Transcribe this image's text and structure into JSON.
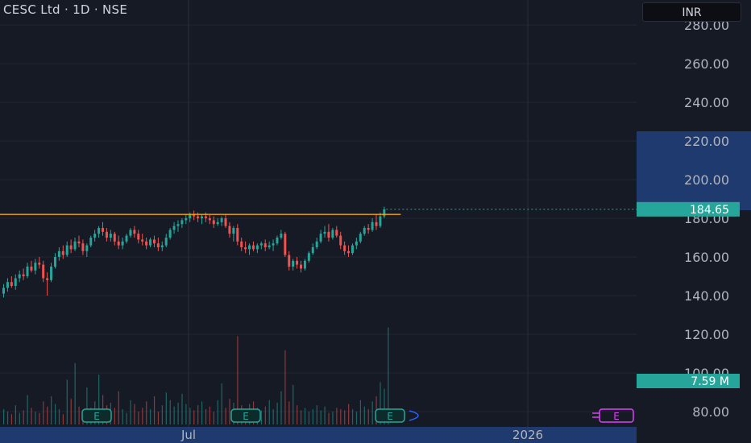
{
  "header": {
    "title": "CESC Ltd · 1D · NSE",
    "currency": "INR"
  },
  "chart_data": {
    "type": "candlestick",
    "y_ticks": [
      "280.00",
      "260.00",
      "240.00",
      "220.00",
      "200.00",
      "180.00",
      "160.00",
      "140.00",
      "120.00",
      "100.00",
      "80.00"
    ],
    "ylim": [
      75,
      285
    ],
    "x_ticks": [
      "Jul",
      "2026"
    ],
    "last_price": "184.65",
    "resistance_level": 182,
    "volume_label": "7.59 M",
    "earnings_marker_label": "E",
    "candles": [
      [
        141,
        146,
        139,
        144
      ],
      [
        144,
        149,
        142,
        147
      ],
      [
        147,
        150,
        144,
        145
      ],
      [
        145,
        151,
        143,
        149
      ],
      [
        149,
        153,
        147,
        151
      ],
      [
        151,
        154,
        148,
        150
      ],
      [
        150,
        157,
        149,
        155
      ],
      [
        155,
        158,
        152,
        153
      ],
      [
        153,
        159,
        151,
        157
      ],
      [
        157,
        160,
        154,
        156
      ],
      [
        156,
        158,
        147,
        149
      ],
      [
        149,
        152,
        140,
        148
      ],
      [
        148,
        157,
        147,
        155
      ],
      [
        155,
        162,
        154,
        160
      ],
      [
        160,
        165,
        158,
        163
      ],
      [
        163,
        166,
        159,
        161
      ],
      [
        161,
        168,
        160,
        166
      ],
      [
        166,
        169,
        162,
        164
      ],
      [
        164,
        170,
        163,
        168
      ],
      [
        168,
        171,
        165,
        167
      ],
      [
        167,
        169,
        161,
        163
      ],
      [
        163,
        167,
        160,
        166
      ],
      [
        166,
        171,
        165,
        170
      ],
      [
        170,
        174,
        168,
        172
      ],
      [
        172,
        176,
        170,
        175
      ],
      [
        175,
        178,
        171,
        173
      ],
      [
        173,
        175,
        168,
        170
      ],
      [
        170,
        174,
        168,
        172
      ],
      [
        172,
        173,
        166,
        168
      ],
      [
        168,
        171,
        164,
        166
      ],
      [
        166,
        170,
        164,
        168
      ],
      [
        168,
        172,
        167,
        171
      ],
      [
        171,
        175,
        170,
        174
      ],
      [
        174,
        176,
        170,
        172
      ],
      [
        172,
        174,
        167,
        169
      ],
      [
        169,
        172,
        166,
        168
      ],
      [
        168,
        170,
        164,
        166
      ],
      [
        166,
        170,
        165,
        169
      ],
      [
        169,
        171,
        165,
        167
      ],
      [
        167,
        170,
        163,
        165
      ],
      [
        165,
        168,
        163,
        166
      ],
      [
        166,
        172,
        165,
        170
      ],
      [
        170,
        175,
        169,
        174
      ],
      [
        174,
        178,
        172,
        176
      ],
      [
        176,
        179,
        173,
        177
      ],
      [
        177,
        180,
        175,
        179
      ],
      [
        179,
        182,
        177,
        180
      ],
      [
        180,
        183,
        178,
        182
      ],
      [
        182,
        184,
        179,
        181
      ],
      [
        181,
        183,
        178,
        180
      ],
      [
        180,
        182,
        177,
        181
      ],
      [
        181,
        183,
        178,
        180
      ],
      [
        180,
        182,
        177,
        179
      ],
      [
        179,
        181,
        175,
        177
      ],
      [
        177,
        180,
        176,
        178
      ],
      [
        178,
        181,
        176,
        180
      ],
      [
        180,
        182,
        175,
        176
      ],
      [
        176,
        178,
        170,
        172
      ],
      [
        172,
        176,
        168,
        175
      ],
      [
        175,
        177,
        166,
        168
      ],
      [
        168,
        170,
        163,
        165
      ],
      [
        165,
        168,
        162,
        164
      ],
      [
        164,
        167,
        161,
        166
      ],
      [
        166,
        168,
        163,
        164
      ],
      [
        164,
        167,
        162,
        166
      ],
      [
        166,
        168,
        164,
        167
      ],
      [
        167,
        169,
        163,
        165
      ],
      [
        165,
        168,
        164,
        166
      ],
      [
        166,
        169,
        163,
        167
      ],
      [
        167,
        171,
        166,
        170
      ],
      [
        170,
        174,
        169,
        172
      ],
      [
        172,
        173,
        160,
        161
      ],
      [
        161,
        163,
        153,
        155
      ],
      [
        155,
        159,
        153,
        158
      ],
      [
        158,
        160,
        154,
        156
      ],
      [
        156,
        158,
        152,
        154
      ],
      [
        154,
        159,
        153,
        158
      ],
      [
        158,
        163,
        157,
        162
      ],
      [
        162,
        167,
        161,
        165
      ],
      [
        165,
        170,
        164,
        168
      ],
      [
        168,
        174,
        167,
        172
      ],
      [
        172,
        176,
        170,
        173
      ],
      [
        173,
        177,
        168,
        170
      ],
      [
        170,
        175,
        169,
        174
      ],
      [
        174,
        176,
        170,
        171
      ],
      [
        171,
        173,
        164,
        166
      ],
      [
        166,
        168,
        161,
        163
      ],
      [
        163,
        166,
        160,
        162
      ],
      [
        162,
        167,
        161,
        166
      ],
      [
        166,
        170,
        164,
        168
      ],
      [
        168,
        173,
        167,
        172
      ],
      [
        172,
        176,
        171,
        175
      ],
      [
        175,
        177,
        172,
        174
      ],
      [
        174,
        180,
        173,
        178
      ],
      [
        178,
        182,
        174,
        176
      ],
      [
        176,
        183,
        175,
        181
      ],
      [
        181,
        186,
        180,
        184.65
      ]
    ],
    "volumes": [
      1.2,
      1.0,
      0.8,
      1.5,
      0.9,
      1.1,
      2.3,
      1.3,
      1.0,
      0.9,
      1.8,
      1.4,
      2.2,
      1.6,
      1.2,
      0.8,
      3.5,
      2.0,
      4.8,
      1.4,
      1.1,
      2.9,
      1.3,
      1.8,
      3.9,
      2.3,
      1.5,
      1.7,
      1.3,
      2.6,
      1.2,
      0.9,
      1.9,
      1.6,
      1.0,
      1.3,
      1.8,
      1.2,
      2.2,
      1.0,
      1.5,
      2.5,
      1.9,
      1.4,
      1.7,
      2.4,
      1.6,
      1.3,
      1.1,
      1.5,
      1.8,
      1.2,
      1.4,
      1.0,
      1.9,
      3.2,
      1.3,
      2.0,
      1.7,
      6.9,
      1.5,
      1.2,
      1.6,
      1.8,
      1.3,
      1.1,
      1.4,
      1.9,
      1.2,
      1.7,
      2.6,
      5.8,
      1.8,
      3.1,
      1.5,
      1.1,
      1.3,
      1.0,
      1.2,
      1.5,
      1.1,
      1.4,
      0.9,
      1.0,
      1.3,
      1.2,
      1.1,
      1.6,
      1.2,
      1.0,
      1.9,
      1.4,
      1.2,
      1.8,
      2.2,
      3.3,
      2.8,
      7.59
    ]
  }
}
